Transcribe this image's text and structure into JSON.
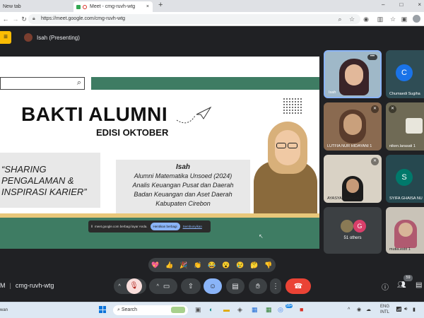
{
  "browser": {
    "tabs": [
      {
        "label": "New tab"
      },
      {
        "label": "Meet - cmg-ruvh-wtg"
      }
    ],
    "url": "https://meet.google.com/cmg-ruvh-wtg",
    "new_tab_glyph": "+",
    "window_controls": [
      "–",
      "□",
      "×"
    ]
  },
  "meet": {
    "presenter_label": "Isah (Presenting)",
    "meeting_code": "cmg-ruvh-wtg",
    "time_fragment": "M",
    "participant_count": "59",
    "others_label": "51 others",
    "others_avatar_letter": "G"
  },
  "slide": {
    "title": "BAKTI ALUMNI",
    "subtitle": "EDISI OKTOBER",
    "quote_lines": [
      "“SHARING",
      "PENGALAMAN &",
      "INSPIRASI KARIER”"
    ],
    "speaker_name": "Isah",
    "speaker_lines": [
      "Alumni Matematika Unsoed (2024)",
      "Analis Keuangan Pusat dan Daerah",
      "Badan Keuangan dan Aset Daerah",
      "Kabupaten Cirebon"
    ]
  },
  "share_notice": {
    "text": "meet.google.com berbagi layar Anda.",
    "stop_label": "Hentikan berbagi",
    "hide_label": "Sembunyikan"
  },
  "participants": [
    {
      "name": "Isah"
    },
    {
      "name": "Chumaedi Sugiha",
      "letter": "C"
    },
    {
      "name": "LUTFIA NUR HIDAYANI 1"
    },
    {
      "name": "niken.larasati 1"
    },
    {
      "name": "AYASYA GHAYDA 1"
    },
    {
      "name": "SYIFA GHAISA NU",
      "letter": "S"
    },
    {
      "name": "mutia.estri 1"
    }
  ],
  "reactions": [
    "💖",
    "👍",
    "🎉",
    "👏",
    "😂",
    "😮",
    "😢",
    "🤔",
    "👎"
  ],
  "taskbar": {
    "search_placeholder": "Search",
    "lang_line1": "ENG",
    "lang_line2": "INTL",
    "weather_fragment": "wan",
    "badge": "99+"
  },
  "colors": {
    "slide_green": "#3e7c63",
    "end_call_red": "#ea4335",
    "active_blue": "#8ab4f8"
  }
}
